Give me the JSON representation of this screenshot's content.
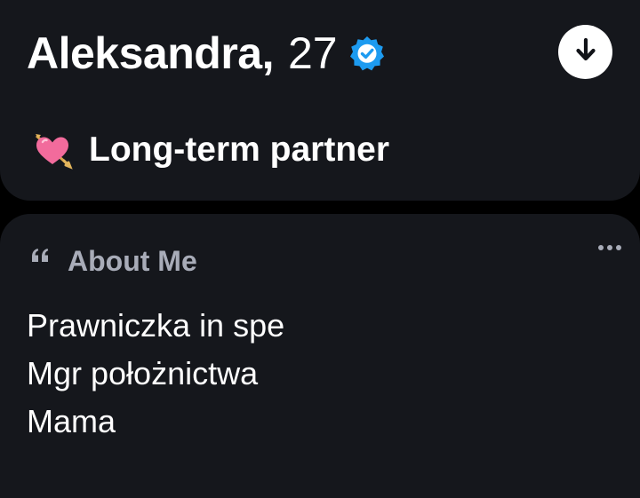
{
  "profile": {
    "name": "Aleksandra,",
    "age": "27",
    "verified_icon": "verified-badge-icon",
    "download_icon": "arrow-down-icon"
  },
  "goal": {
    "emoji": "heart-with-arrow-icon",
    "label": "Long-term partner"
  },
  "about": {
    "quote_icon": "quote-icon",
    "title": "About Me",
    "more_icon": "more-dots-icon",
    "lines": [
      "Prawniczka in spe",
      "Mgr położnictwa",
      "Mama"
    ]
  },
  "colors": {
    "background": "#000000",
    "card": "#15171c",
    "verified_blue": "#1d9bf0",
    "muted_text": "#a8acb8",
    "heart_pink": "#f26b9c"
  }
}
